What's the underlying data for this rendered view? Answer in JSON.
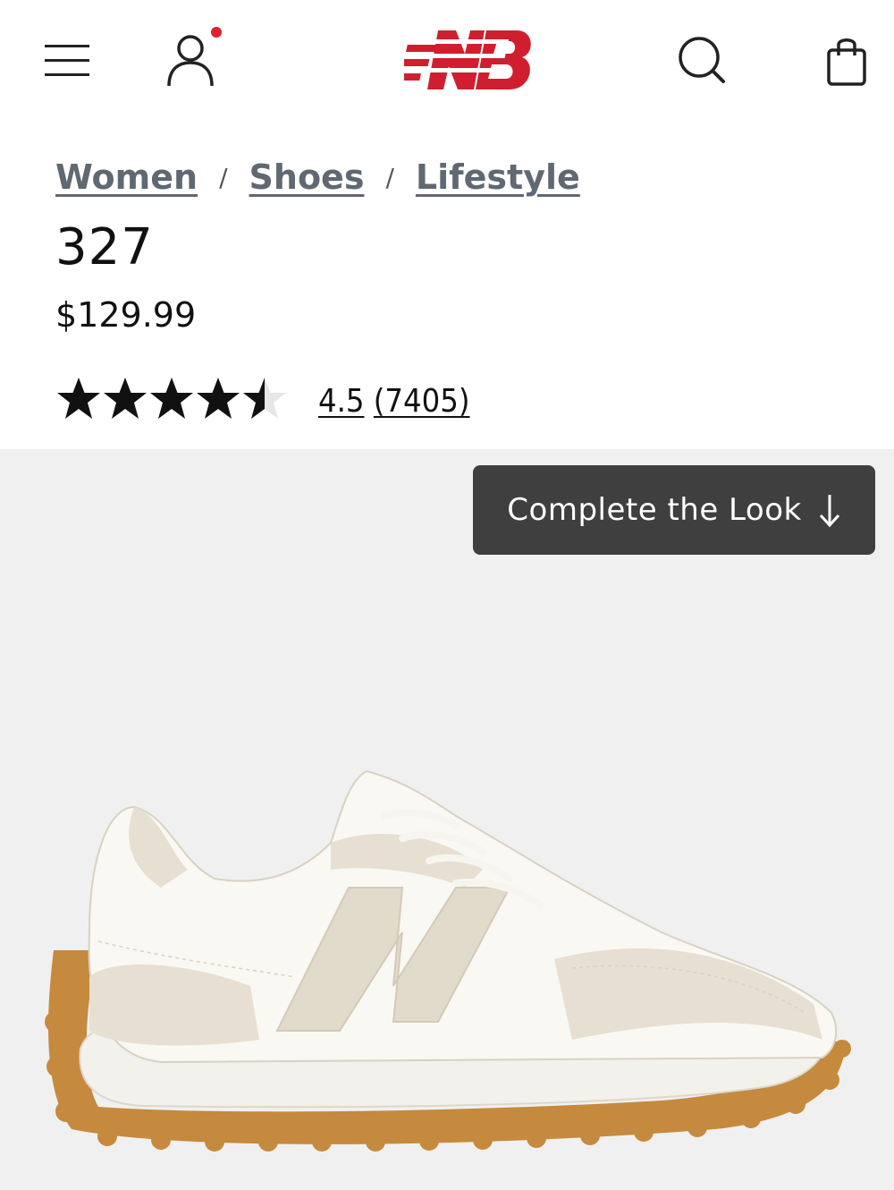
{
  "header": {
    "menu_icon": "hamburger-menu-icon",
    "account_icon": "user-account-icon",
    "notification_dot_color": "#e0202f",
    "logo": "new-balance-logo",
    "logo_color": "#cf1f2f",
    "search_icon": "search-icon",
    "cart_icon": "shopping-bag-icon"
  },
  "breadcrumb": {
    "items": [
      "Women",
      "Shoes",
      "Lifestyle"
    ],
    "separator": "/"
  },
  "product": {
    "name": "327",
    "price": "$129.99",
    "rating": {
      "value": "4.5",
      "count": "(7405)",
      "stars_filled": 4.5,
      "stars_max": 5
    }
  },
  "image": {
    "cta_label": "Complete the Look",
    "cta_icon": "arrow-down-icon",
    "background_color": "#f0f0f0"
  }
}
